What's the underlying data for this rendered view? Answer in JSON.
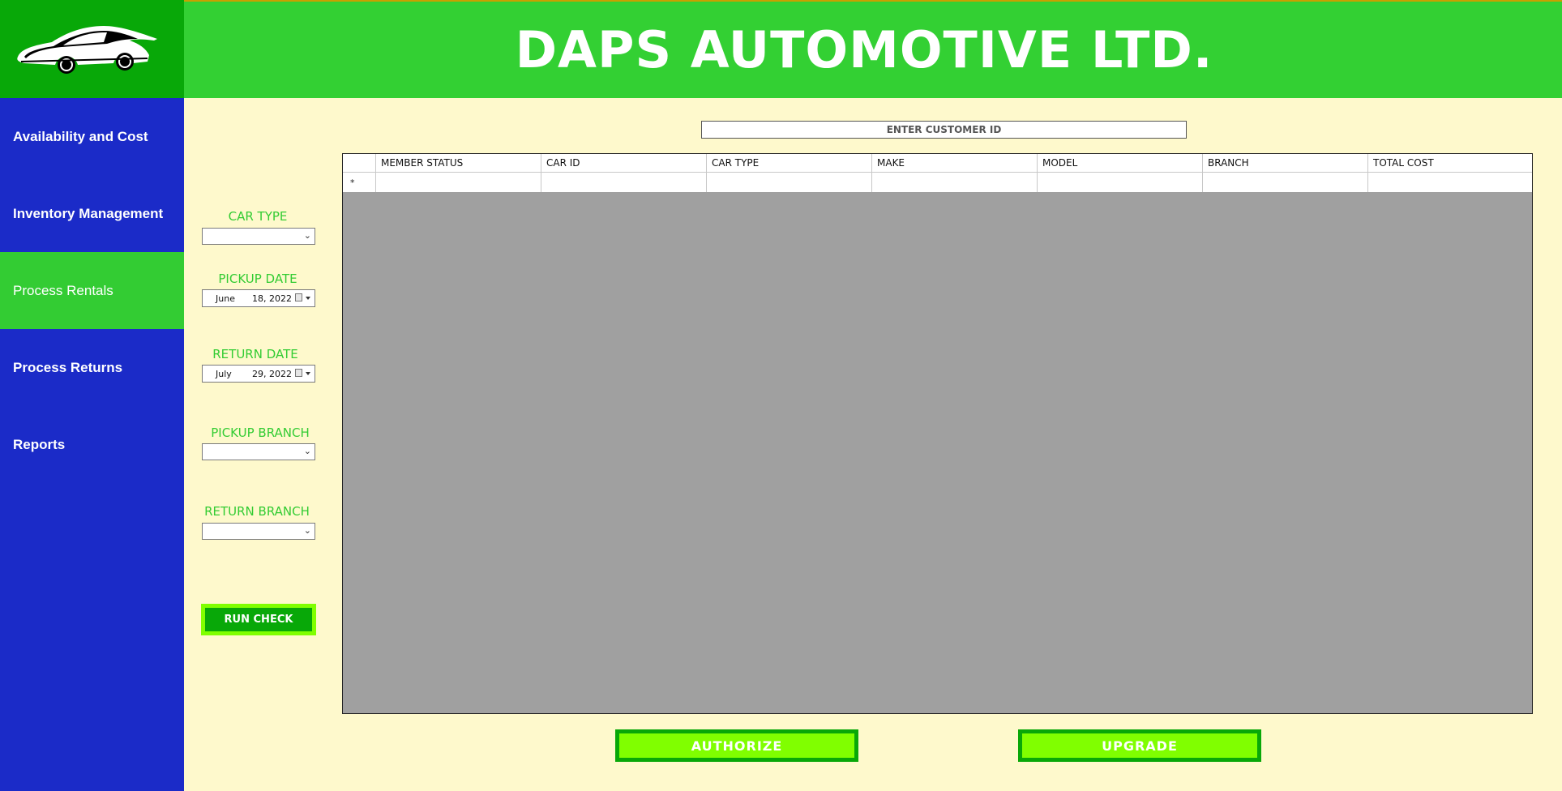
{
  "app": {
    "title": "DAPS AUTOMOTIVE LTD."
  },
  "sidebar": {
    "logo_icon": "sports-car-icon",
    "items": [
      {
        "label": "Availability and Cost"
      },
      {
        "label": "Inventory Management"
      },
      {
        "label": "Process Rentals",
        "active": true
      },
      {
        "label": "Process Returns"
      },
      {
        "label": "Reports"
      }
    ]
  },
  "customer_search": {
    "placeholder": "ENTER CUSTOMER ID",
    "value": ""
  },
  "form": {
    "car_type_label": "CAR TYPE",
    "car_type_value": "",
    "pickup_date_label": "PICKUP DATE",
    "pickup_date": {
      "month": "June",
      "day_year": "18, 2022"
    },
    "return_date_label": "RETURN DATE",
    "return_date": {
      "month": "July",
      "day_year": "29, 2022"
    },
    "pickup_branch_label": "PICKUP BRANCH",
    "pickup_branch_value": "",
    "return_branch_label": "RETURN BRANCH",
    "return_branch_value": "",
    "run_check_label": "RUN CHECK"
  },
  "grid": {
    "columns": [
      "MEMBER STATUS",
      "CAR ID",
      "CAR TYPE",
      "MAKE",
      "MODEL",
      "BRANCH",
      "TOTAL COST"
    ],
    "new_row_marker": "*",
    "rows": []
  },
  "actions": {
    "authorize_label": "AUTHORIZE",
    "upgrade_label": "UPGRADE"
  },
  "colors": {
    "sidebar": "#1b2bc8",
    "header": "#33d033",
    "logo_bg": "#08a808",
    "active_nav": "#33cc33",
    "content_bg": "#fef9cc",
    "accent_lime": "#80ff00",
    "grid_bg": "#a0a0a0"
  }
}
